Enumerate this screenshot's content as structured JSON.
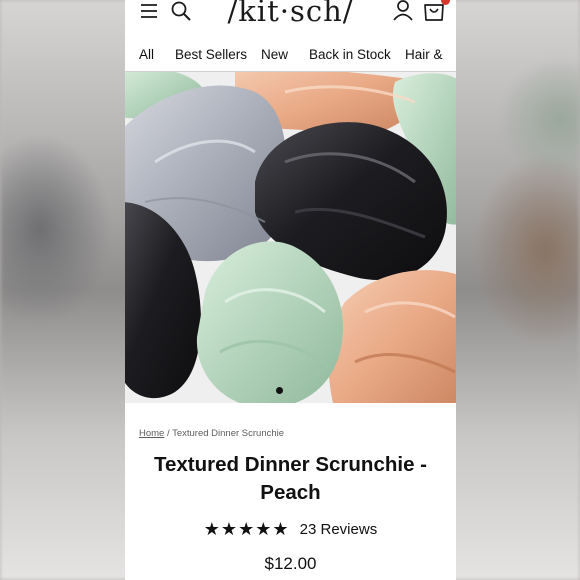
{
  "header": {
    "logo_text": "/kit·sch/",
    "cart_badge_color": "#d6382d"
  },
  "nav": {
    "items": [
      {
        "label": "All"
      },
      {
        "label": "Best Sellers"
      },
      {
        "label": "New"
      },
      {
        "label": "Back in Stock"
      },
      {
        "label": "Hair &"
      }
    ]
  },
  "gallery": {
    "current_slide": 1,
    "image_colors": {
      "sage": "#b7d6bf",
      "silver": "#b5b8c2",
      "black": "#1c1c1f",
      "peach": "#ecb192"
    }
  },
  "breadcrumb": {
    "home": "Home",
    "separator": "/",
    "current": "Textured Dinner Scrunchie"
  },
  "product": {
    "title": "Textured Dinner Scrunchie - Peach",
    "stars_display": "★★★★★",
    "rating": 5,
    "reviews_label": "23 Reviews",
    "price": "$12.00"
  },
  "icons": [
    "menu-icon",
    "search-icon",
    "account-icon",
    "bag-icon"
  ]
}
